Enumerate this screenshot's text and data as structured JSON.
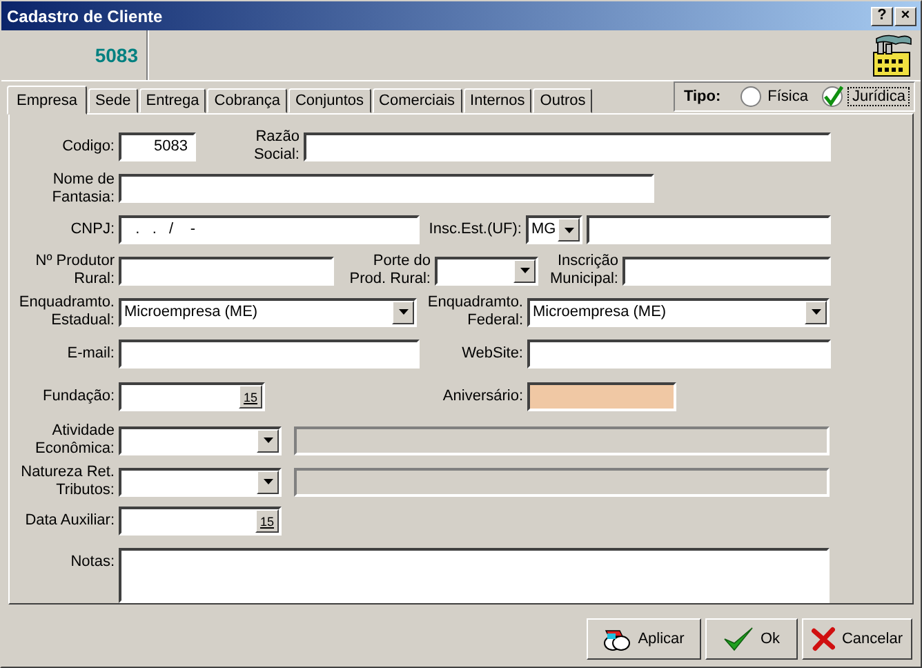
{
  "window": {
    "title": "Cadastro de Cliente",
    "buttons": [
      "?",
      "×"
    ]
  },
  "header": {
    "code": "5083"
  },
  "tabs": [
    {
      "label": "Empresa",
      "selected": true
    },
    {
      "label": "Sede",
      "selected": false
    },
    {
      "label": "Entrega",
      "selected": false
    },
    {
      "label": "Cobrança",
      "selected": false
    },
    {
      "label": "Conjuntos",
      "selected": false
    },
    {
      "label": "Comerciais",
      "selected": false
    },
    {
      "label": "Internos",
      "selected": false
    },
    {
      "label": "Outros",
      "selected": false
    }
  ],
  "tipo": {
    "label": "Tipo:",
    "options": [
      {
        "label": "Física",
        "selected": false
      },
      {
        "label": "Jurídica",
        "selected": true
      }
    ]
  },
  "rows": [
    [
      {
        "kind": "label",
        "text": "Codigo:"
      },
      {
        "kind": "text",
        "value": "5083"
      },
      {
        "kind": "label",
        "text": "Razão\nSocial:"
      },
      {
        "kind": "text"
      }
    ],
    [
      {
        "kind": "label",
        "text": "Nome de\nFantasia:"
      },
      {
        "kind": "text"
      }
    ],
    [
      {
        "kind": "label",
        "text": "CNPJ:"
      },
      {
        "kind": "text",
        "value": "  .   .   /    -"
      },
      {
        "kind": "label",
        "text": "Insc.Est.(UF):"
      },
      {
        "kind": "combo",
        "value": "MG"
      },
      {
        "kind": "text"
      }
    ],
    [
      {
        "kind": "label",
        "text": "Nº Produtor\nRural:"
      },
      {
        "kind": "text"
      },
      {
        "kind": "label",
        "text": "Porte do\nProd. Rural:"
      },
      {
        "kind": "combo"
      },
      {
        "kind": "label",
        "text": "Inscrição\nMunicipal:"
      },
      {
        "kind": "text"
      }
    ],
    [
      {
        "kind": "label",
        "text": "Enquadramto.\nEstadual:"
      },
      {
        "kind": "combo",
        "value": "Microempresa (ME)"
      },
      {
        "kind": "label",
        "text": "Enquadramto.\nFederal:"
      },
      {
        "kind": "combo",
        "value": "Microempresa (ME)"
      }
    ],
    [
      {
        "kind": "label",
        "text": "E-mail:"
      },
      {
        "kind": "text"
      },
      {
        "kind": "label",
        "text": "WebSite:"
      },
      {
        "kind": "text"
      }
    ],
    [
      {
        "kind": "label",
        "text": "Fundação:"
      },
      {
        "kind": "date",
        "button": "15"
      },
      {
        "kind": "label",
        "text": "Aniversário:"
      },
      {
        "kind": "highlight"
      }
    ],
    [
      {
        "kind": "label",
        "text": "Atividade\nEconômica:"
      },
      {
        "kind": "combo"
      },
      {
        "kind": "readonly"
      }
    ],
    [
      {
        "kind": "label",
        "text": "Natureza Ret.\nTributos:"
      },
      {
        "kind": "combo"
      },
      {
        "kind": "readonly"
      }
    ],
    [
      {
        "kind": "label",
        "text": "Data Auxiliar:"
      },
      {
        "kind": "date",
        "button": "15"
      }
    ],
    [
      {
        "kind": "label",
        "text": "Notas:"
      },
      {
        "kind": "memo"
      }
    ]
  ],
  "buttons": [
    {
      "label": "Aplicar"
    },
    {
      "label": "Ok"
    },
    {
      "label": "Cancelar"
    }
  ]
}
